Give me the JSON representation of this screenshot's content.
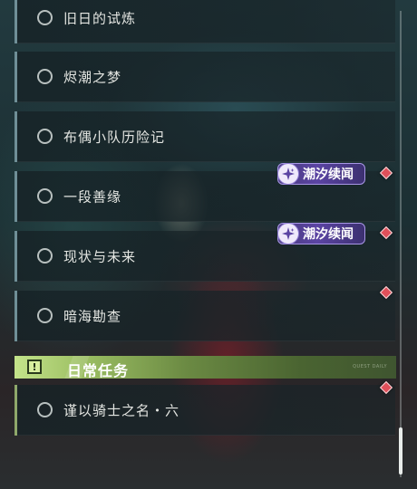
{
  "quests": [
    {
      "id": "q1",
      "label": "旧日的试炼"
    },
    {
      "id": "q2",
      "label": "烬潮之梦"
    },
    {
      "id": "q3",
      "label": "布偶小队历险记"
    },
    {
      "id": "q4",
      "label": "一段善缘",
      "badge": "潮汐续闻"
    },
    {
      "id": "q5",
      "label": "现状与未来",
      "badge": "潮汐续闻"
    },
    {
      "id": "q6",
      "label": "暗海勘查"
    }
  ],
  "daily_section": {
    "title": "日常任务",
    "deco_text": "QUEST DAILY"
  },
  "daily_quests": [
    {
      "id": "d1",
      "label": "谨以骑士之名・六"
    }
  ],
  "colors": {
    "badge_bg": "#5b44a3",
    "badge_border": "#a896e6",
    "notification_diamond": "#e0505a",
    "daily_header_accent": "#c4e38a",
    "quest_rail": "#6f8f97"
  },
  "icons": {
    "quest_status": "empty-circle-icon",
    "badge": "sparkle-icon",
    "notification": "red-diamond-icon",
    "section": "alert-square-icon"
  }
}
